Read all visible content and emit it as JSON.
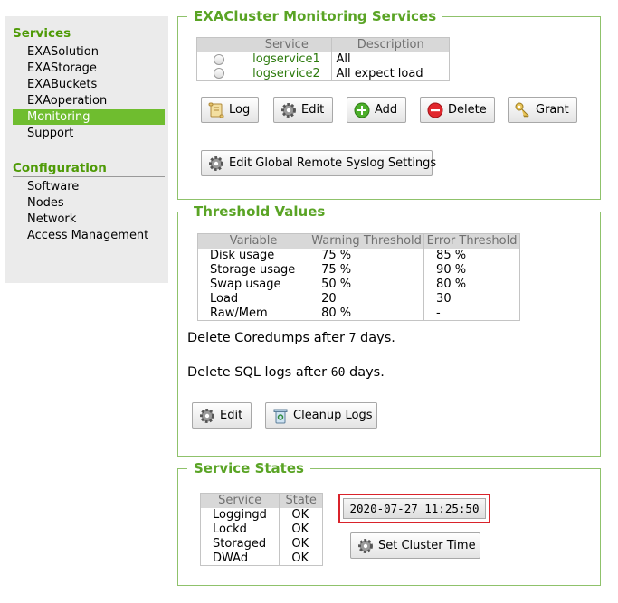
{
  "sidebar": {
    "services_heading": "Services",
    "services_items": [
      "EXASolution",
      "EXAStorage",
      "EXABuckets",
      "EXAoperation",
      "Monitoring",
      "Support"
    ],
    "active_item": "Monitoring",
    "configuration_heading": "Configuration",
    "configuration_items": [
      "Software",
      "Nodes",
      "Network",
      "Access Management"
    ]
  },
  "monitoring_services": {
    "legend": "EXACluster Monitoring Services",
    "columns": [
      "Service",
      "Description"
    ],
    "rows": [
      {
        "service": "logservice1",
        "description": "All"
      },
      {
        "service": "logservice2",
        "description": "All expect load"
      }
    ],
    "buttons": {
      "log": "Log",
      "edit": "Edit",
      "add": "Add",
      "delete": "Delete",
      "grant": "Grant",
      "edit_syslog": "Edit Global Remote Syslog Settings"
    }
  },
  "threshold_values": {
    "legend": "Threshold Values",
    "columns": [
      "Variable",
      "Warning Threshold",
      "Error Threshold"
    ],
    "rows": [
      {
        "variable": "Disk usage",
        "warning": "75 %",
        "error": "85 %"
      },
      {
        "variable": "Storage usage",
        "warning": "75 %",
        "error": "90 %"
      },
      {
        "variable": "Swap usage",
        "warning": "50 %",
        "error": "80 %"
      },
      {
        "variable": "Load",
        "warning": "20",
        "error": "30"
      },
      {
        "variable": "Raw/Mem",
        "warning": "80 %",
        "error": "-"
      }
    ],
    "coredumps_prefix": "Delete Coredumps after ",
    "coredumps_days": "7",
    "coredumps_suffix": " days.",
    "sqllogs_prefix": "Delete SQL logs after ",
    "sqllogs_days": "60",
    "sqllogs_suffix": " days.",
    "buttons": {
      "edit": "Edit",
      "cleanup": "Cleanup Logs"
    }
  },
  "service_states": {
    "legend": "Service States",
    "columns": [
      "Service",
      "State"
    ],
    "rows": [
      {
        "service": "Loggingd",
        "state": "OK"
      },
      {
        "service": "Lockd",
        "state": "OK"
      },
      {
        "service": "Storaged",
        "state": "OK"
      },
      {
        "service": "DWAd",
        "state": "OK"
      }
    ],
    "cluster_time": "2020-07-27 11:25:50",
    "set_time_button": "Set Cluster Time"
  },
  "colors": {
    "accent_green": "#5aa425",
    "active_nav": "#6fbd2f",
    "highlight_red": "#d9232b"
  }
}
